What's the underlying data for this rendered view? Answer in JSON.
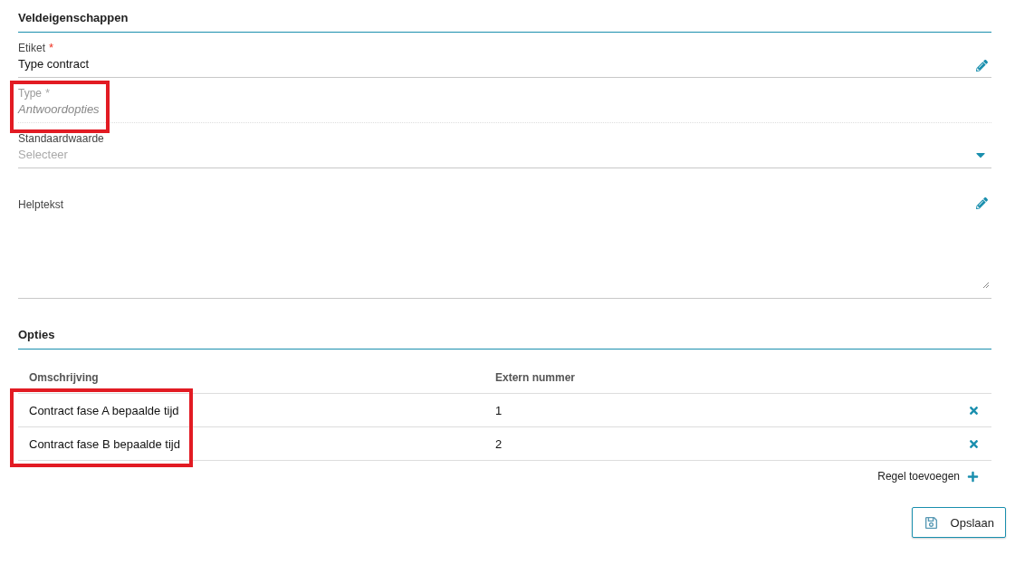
{
  "properties": {
    "title": "Veldeigenschappen",
    "required_mark": "*",
    "fields": [
      {
        "kind": "text",
        "label": "Etiket",
        "required": true,
        "value": "Type contract",
        "disabled": false,
        "highlighted": false
      },
      {
        "kind": "readonly",
        "label": "Type",
        "required": true,
        "value": "Antwoordopties",
        "disabled": true,
        "highlighted": true
      },
      {
        "kind": "select",
        "label": "Standaardwaarde",
        "required": false,
        "placeholder": "Selecteer",
        "disabled": false,
        "highlighted": false
      },
      {
        "kind": "textarea",
        "label": "Helptekst",
        "required": false,
        "disabled": false,
        "highlighted": false
      }
    ]
  },
  "options": {
    "title": "Opties",
    "columns": [
      "Omschrijving",
      "Extern nummer"
    ],
    "description_highlighted": true,
    "rows": [
      {
        "description": "Contract fase A bepaalde tijd",
        "number": "1"
      },
      {
        "description": "Contract fase B bepaalde tijd",
        "number": "2"
      }
    ],
    "add_label": "Regel toevoegen"
  },
  "save_button": "Opslaan"
}
